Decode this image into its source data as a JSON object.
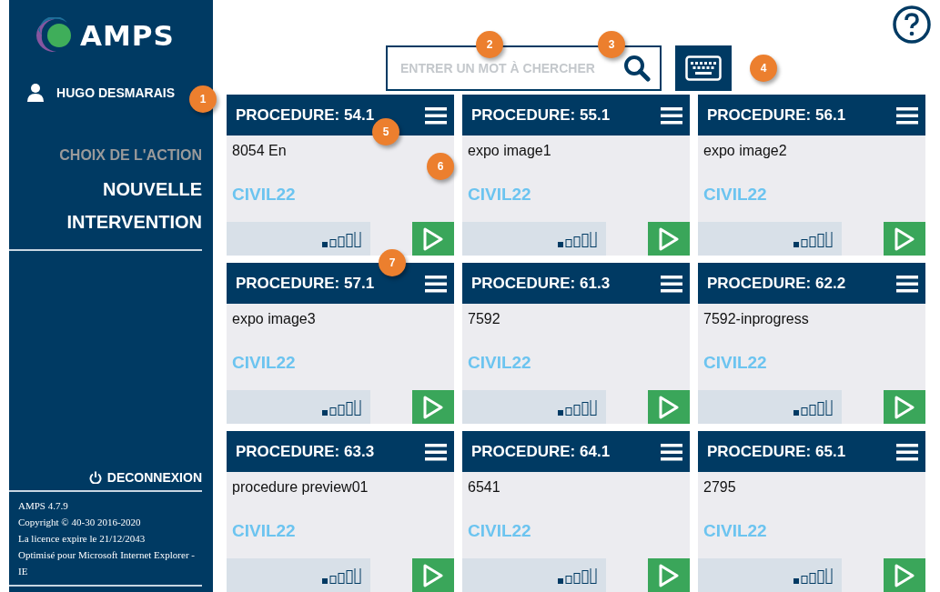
{
  "sidebar": {
    "logo": "AMPS",
    "user": "HUGO DESMARAIS",
    "section_title": "CHOIX DE L'ACTION",
    "action": "NOUVELLE INTERVENTION",
    "logout": "DECONNEXION",
    "footer": [
      "AMPS 4.7.9",
      "Copyright © 40-30 2016-2020",
      "La licence expire le 21/12/2043",
      "Optimisé pour Microsoft Internet Explorer - IE"
    ]
  },
  "search": {
    "placeholder": "ENTRER UN MOT À CHERCHER"
  },
  "cards": [
    {
      "title": "PROCEDURE: 54.1",
      "name": "8054 En",
      "tag": "CIVIL22",
      "level": 0.2
    },
    {
      "title": "PROCEDURE: 55.1",
      "name": "expo image1",
      "tag": "CIVIL22",
      "level": 0.2
    },
    {
      "title": "PROCEDURE: 56.1",
      "name": "expo image2",
      "tag": "CIVIL22",
      "level": 0.2
    },
    {
      "title": "PROCEDURE: 57.1",
      "name": "expo image3",
      "tag": "CIVIL22",
      "level": 0.2
    },
    {
      "title": "PROCEDURE: 61.3",
      "name": "7592",
      "tag": "CIVIL22",
      "level": 0.2
    },
    {
      "title": "PROCEDURE: 62.2",
      "name": "7592-inprogress",
      "tag": "CIVIL22",
      "level": 0.2
    },
    {
      "title": "PROCEDURE: 63.3",
      "name": "procedure preview01",
      "tag": "CIVIL22",
      "level": 0.2
    },
    {
      "title": "PROCEDURE: 64.1",
      "name": "6541",
      "tag": "CIVIL22",
      "level": 0.2
    },
    {
      "title": "PROCEDURE: 65.1",
      "name": "2795",
      "tag": "CIVIL22",
      "level": 0.2
    }
  ],
  "callouts": [
    "1",
    "2",
    "3",
    "4",
    "5",
    "6",
    "7"
  ]
}
